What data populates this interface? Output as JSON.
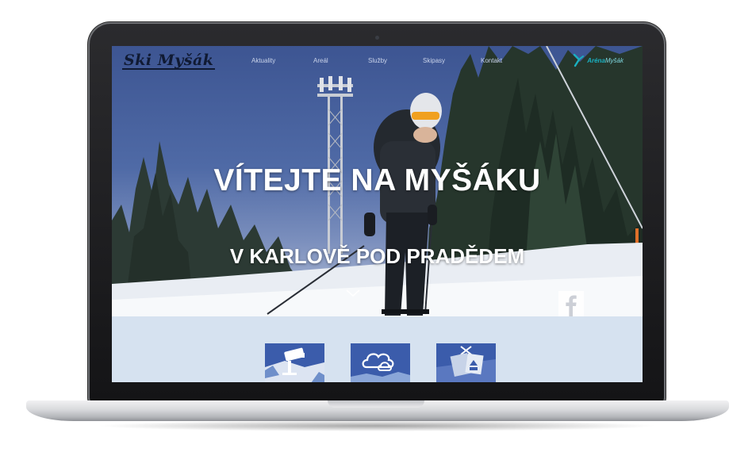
{
  "nav": {
    "logo": "Ski Myšák",
    "items": [
      "Aktuality",
      "Areál",
      "Služby",
      "Skipasy",
      "Kontakt"
    ],
    "partner_logo_text_a": "Aréna",
    "partner_logo_text_b": "Myšák"
  },
  "hero": {
    "title": "VÍTEJTE NA MYŠÁKU",
    "subtitle": "V KARLOVĚ POD PRADĚDEM",
    "scroll_icon": "chevron-down-icon",
    "social_icon": "facebook-icon"
  },
  "tiles": [
    {
      "icon": "webcam-icon"
    },
    {
      "icon": "weather-cloud-icon"
    },
    {
      "icon": "skipass-icon"
    }
  ],
  "colors": {
    "sky": "#3d5592",
    "tile_strip": "#d6e2f0",
    "tile_blue": "#3a5bb0",
    "partner_teal": "#1ab0c0",
    "headline": "#ffffff"
  }
}
